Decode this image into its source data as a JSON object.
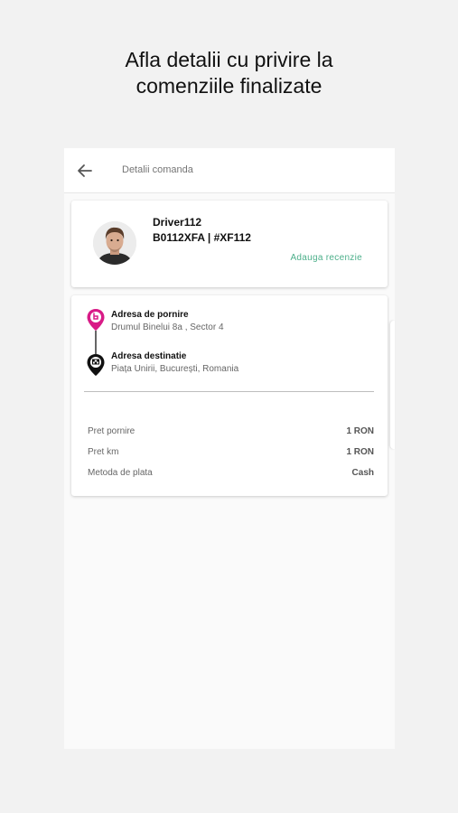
{
  "promo": {
    "line1": "Afla detalii cu privire la",
    "line2": "comenziile finalizate"
  },
  "appbar": {
    "title": "Detalii comanda",
    "back_icon": "arrow-left-icon"
  },
  "driver": {
    "name": "Driver112",
    "plate": "B0112XFA | #XF112",
    "review_label": "Adauga recenzie"
  },
  "trip": {
    "start_label": "Adresa de pornire",
    "start_address": "Drumul Binelui 8a , Sector 4",
    "dest_label": "Adresa destinatie",
    "dest_address": "Piața Unirii, București, Romania"
  },
  "pricing": [
    {
      "label": "Pret pornire",
      "value": "1 RON"
    },
    {
      "label": "Pret km",
      "value": "1 RON"
    },
    {
      "label": "Metoda de plata",
      "value": "Cash"
    }
  ],
  "colors": {
    "accent_green": "#4caf8a",
    "start_pin": "#d81b87",
    "dest_pin": "#111111"
  }
}
